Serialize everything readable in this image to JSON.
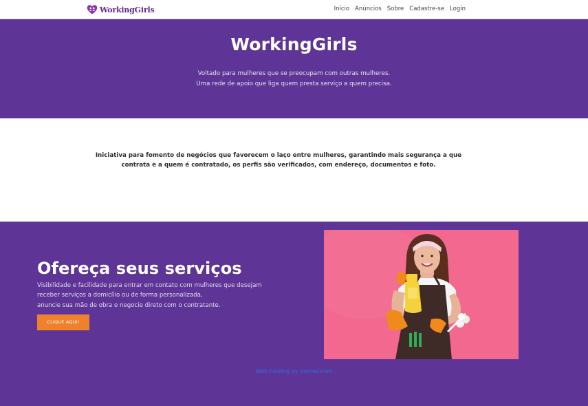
{
  "navbar": {
    "brand": "WorkingGirls",
    "links": [
      "Início",
      "Anúncios",
      "Sobre",
      "Cadastre-se",
      "Login"
    ]
  },
  "hero": {
    "title": "WorkingGirls",
    "subtitle_lines": [
      "Voltado para mulheres que se preocupam com outras mulheres.",
      "Uma rede de apoio que liga quem presta serviço a quem precisa."
    ]
  },
  "about": {
    "text": "Iniciativa para fomento de negócios que favorecem o laço entre mulheres, garantindo mais segurança a que contrata e a quem é contratado, os perfis são verificados, com endereço, documentos e foto."
  },
  "offer": {
    "title": "Ofereça seus serviços",
    "description_lines": [
      "Visibilidade e facilidade para entrar em contato com mulheres que desejam",
      "receber serviços a domicílio ou de forma personalizada,",
      "anuncie sua mão de obra e negocie direto com o contratante."
    ],
    "button_label": "CLIQUE AQUI!",
    "image_icon": "smiling-cleaning-woman-photo"
  },
  "footer": {
    "hosting_text": "Web hosting by Somee.com"
  },
  "colors": {
    "brand_purple": "#5e3596",
    "cta_orange": "#f0812b",
    "photo_pink": "#f2688f",
    "link_blue": "#2f6de0"
  }
}
